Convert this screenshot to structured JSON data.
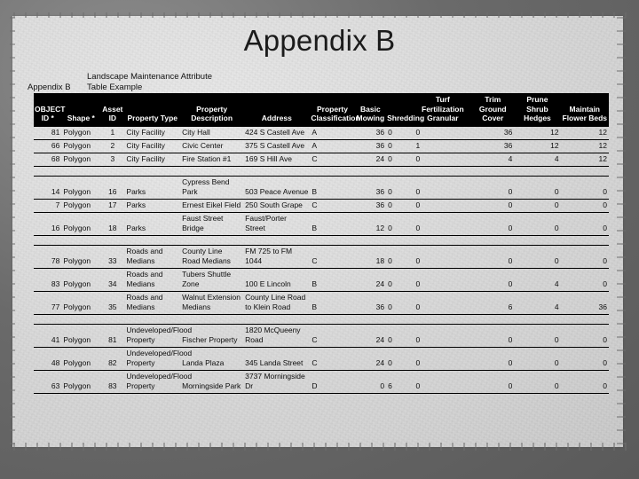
{
  "slide": {
    "title": "Appendix B",
    "caption_left": "Appendix B",
    "caption_right": "Landscape Maintenance Attribute Table Example"
  },
  "table": {
    "columns": [
      "OBJECT ID *",
      "Shape *",
      "Asset ID",
      "Property Type",
      "Property Description",
      "Address",
      "Property Classification",
      "Basic Mowing",
      "Shredding",
      "Turf Fertilization Granular",
      "Trim Ground Cover",
      "Prune Shrub Hedges",
      "Maintain Flower Beds"
    ],
    "groups": [
      {
        "name": "city-facility",
        "rows": [
          {
            "object_id": "81",
            "shape": "Polygon",
            "asset_id": "1",
            "property_type": "City Facility",
            "property_description": "City Hall",
            "address": "424 S Castell Ave",
            "property_classification": "A",
            "basic_mowing": "36",
            "shredding": "0",
            "turf_fertilization_granular": "0",
            "trim_ground_cover": "36",
            "prune_shrub_hedges": "12",
            "maintain_flower_beds": "12"
          },
          {
            "object_id": "66",
            "shape": "Polygon",
            "asset_id": "2",
            "property_type": "City Facility",
            "property_description": "Civic Center",
            "address": "375 S Castell Ave",
            "property_classification": "A",
            "basic_mowing": "36",
            "shredding": "0",
            "turf_fertilization_granular": "1",
            "trim_ground_cover": "36",
            "prune_shrub_hedges": "12",
            "maintain_flower_beds": "12"
          },
          {
            "object_id": "68",
            "shape": "Polygon",
            "asset_id": "3",
            "property_type": "City Facility",
            "property_description": "Fire Station #1",
            "address": "169 S Hill Ave",
            "property_classification": "C",
            "basic_mowing": "24",
            "shredding": "0",
            "turf_fertilization_granular": "0",
            "trim_ground_cover": "4",
            "prune_shrub_hedges": "4",
            "maintain_flower_beds": "12"
          }
        ]
      },
      {
        "name": "parks",
        "rows": [
          {
            "object_id": "14",
            "shape": "Polygon",
            "asset_id": "16",
            "property_type": "Parks",
            "property_description": "Cypress Bend Park",
            "address": "503 Peace Avenue",
            "property_classification": "B",
            "basic_mowing": "36",
            "shredding": "0",
            "turf_fertilization_granular": "0",
            "trim_ground_cover": "0",
            "prune_shrub_hedges": "0",
            "maintain_flower_beds": "0"
          },
          {
            "object_id": "7",
            "shape": "Polygon",
            "asset_id": "17",
            "property_type": "Parks",
            "property_description": "Ernest Eikel Field",
            "address": "250 South Grape",
            "property_classification": "C",
            "basic_mowing": "36",
            "shredding": "0",
            "turf_fertilization_granular": "0",
            "trim_ground_cover": "0",
            "prune_shrub_hedges": "0",
            "maintain_flower_beds": "0"
          },
          {
            "object_id": "16",
            "shape": "Polygon",
            "asset_id": "18",
            "property_type": "Parks",
            "property_description": "Faust Street Bridge",
            "address": "Faust/Porter Street",
            "property_classification": "B",
            "basic_mowing": "12",
            "shredding": "0",
            "turf_fertilization_granular": "0",
            "trim_ground_cover": "0",
            "prune_shrub_hedges": "0",
            "maintain_flower_beds": "0"
          }
        ]
      },
      {
        "name": "roads-and-medians",
        "rows": [
          {
            "object_id": "78",
            "shape": "Polygon",
            "asset_id": "33",
            "property_type": "Roads and Medians",
            "property_description": "County Line Road Medians",
            "address": "FM 725 to FM 1044",
            "property_classification": "C",
            "basic_mowing": "18",
            "shredding": "0",
            "turf_fertilization_granular": "0",
            "trim_ground_cover": "0",
            "prune_shrub_hedges": "0",
            "maintain_flower_beds": "0"
          },
          {
            "object_id": "83",
            "shape": "Polygon",
            "asset_id": "34",
            "property_type": "Roads and Medians",
            "property_description": "Tubers Shuttle Zone",
            "address": "100 E Lincoln",
            "property_classification": "B",
            "basic_mowing": "24",
            "shredding": "0",
            "turf_fertilization_granular": "0",
            "trim_ground_cover": "0",
            "prune_shrub_hedges": "4",
            "maintain_flower_beds": "0"
          },
          {
            "object_id": "77",
            "shape": "Polygon",
            "asset_id": "35",
            "property_type": "Roads and Medians",
            "property_description": "Walnut Extension Medians",
            "address": "County Line Road to Klein Road",
            "property_classification": "B",
            "basic_mowing": "36",
            "shredding": "0",
            "turf_fertilization_granular": "0",
            "trim_ground_cover": "6",
            "prune_shrub_hedges": "4",
            "maintain_flower_beds": "36"
          }
        ]
      },
      {
        "name": "undeveloped-flood-property",
        "rows": [
          {
            "object_id": "41",
            "shape": "Polygon",
            "asset_id": "81",
            "property_type": "Undeveloped/Flood Property",
            "property_description": "Fischer Property",
            "address": "1820 McQueeny Road",
            "property_classification": "C",
            "basic_mowing": "24",
            "shredding": "0",
            "turf_fertilization_granular": "0",
            "trim_ground_cover": "0",
            "prune_shrub_hedges": "0",
            "maintain_flower_beds": "0"
          },
          {
            "object_id": "48",
            "shape": "Polygon",
            "asset_id": "82",
            "property_type": "Undeveloped/Flood Property",
            "property_description": "Landa Plaza",
            "address": "345 Landa Street",
            "property_classification": "C",
            "basic_mowing": "24",
            "shredding": "0",
            "turf_fertilization_granular": "0",
            "trim_ground_cover": "0",
            "prune_shrub_hedges": "0",
            "maintain_flower_beds": "0"
          },
          {
            "object_id": "63",
            "shape": "Polygon",
            "asset_id": "83",
            "property_type": "Undeveloped/Flood Property",
            "property_description": "Morningside Park",
            "address": "3737 Morningside Dr",
            "property_classification": "D",
            "basic_mowing": "0",
            "shredding": "6",
            "turf_fertilization_granular": "0",
            "trim_ground_cover": "0",
            "prune_shrub_hedges": "0",
            "maintain_flower_beds": "0"
          }
        ]
      }
    ]
  },
  "colors": {
    "header_background": "#000000",
    "header_text": "#ffffff",
    "paper": "#dedede",
    "border": "#000000"
  }
}
